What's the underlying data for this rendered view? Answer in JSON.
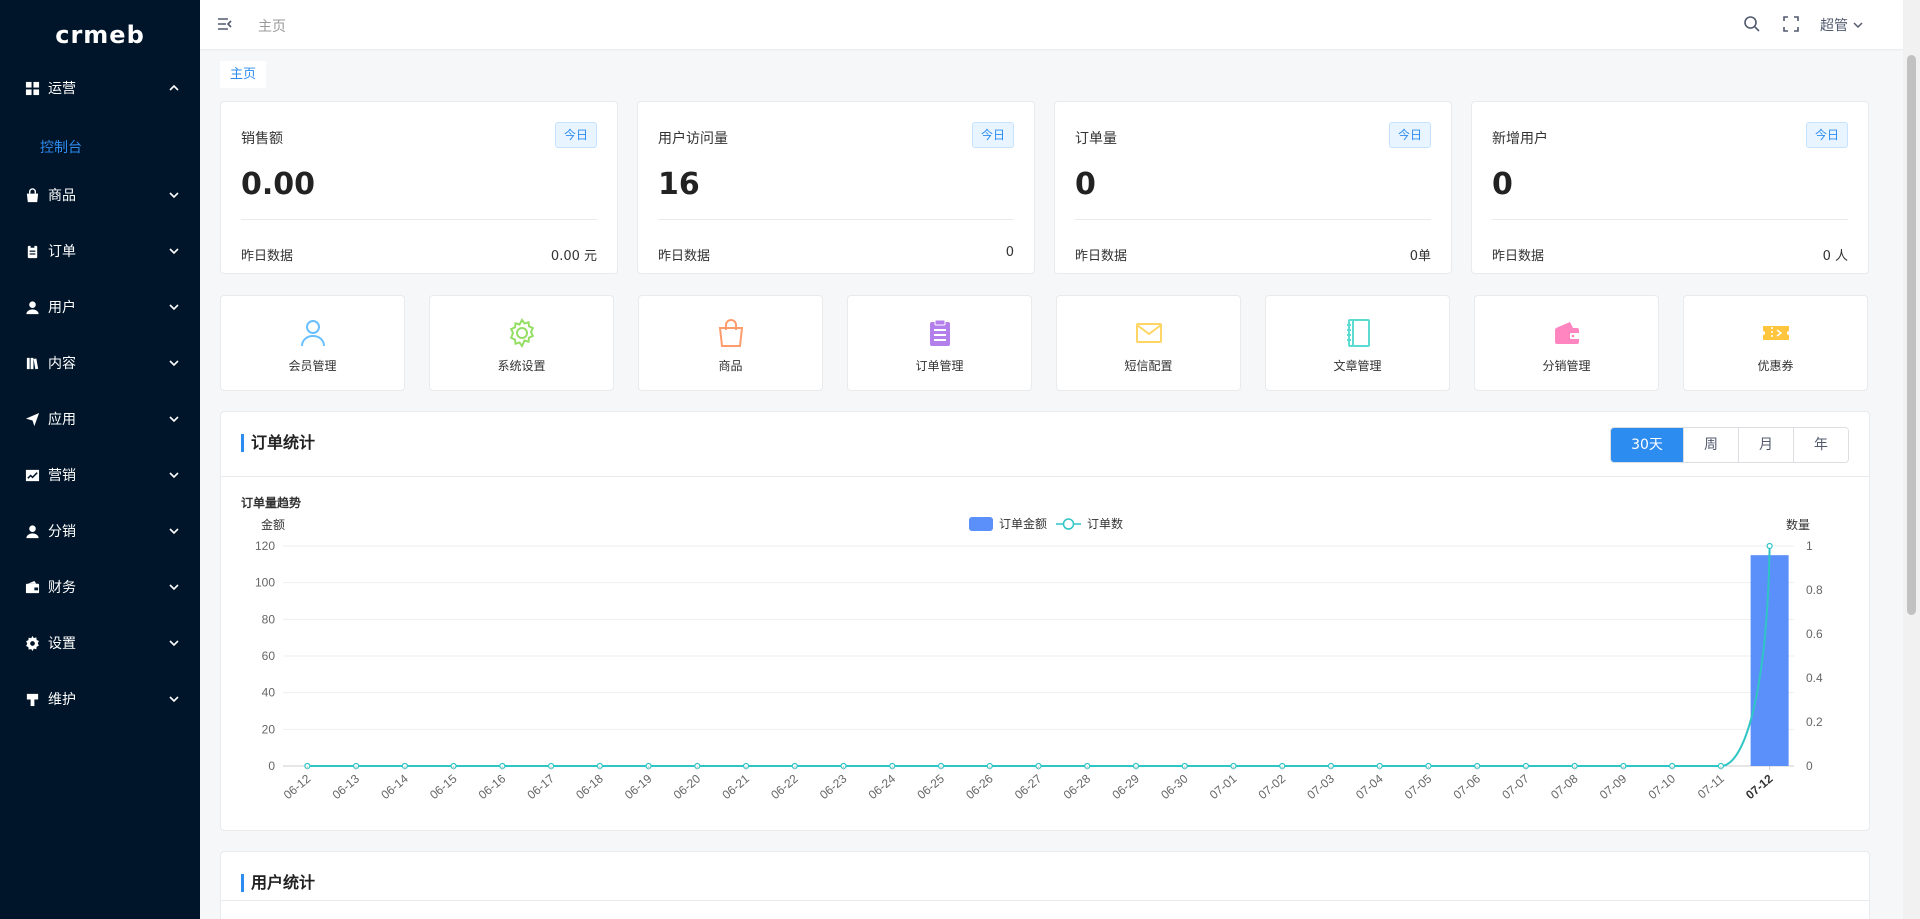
{
  "brand": {
    "logo_text": "crmeb"
  },
  "sidebar": {
    "items": [
      {
        "label": "运营",
        "icon": "grid-icon",
        "expanded": true
      },
      {
        "label": "商品",
        "icon": "bag-icon"
      },
      {
        "label": "订单",
        "icon": "clipboard-icon"
      },
      {
        "label": "用户",
        "icon": "user-icon"
      },
      {
        "label": "内容",
        "icon": "book-icon"
      },
      {
        "label": "应用",
        "icon": "send-icon"
      },
      {
        "label": "营销",
        "icon": "chart-icon"
      },
      {
        "label": "分销",
        "icon": "user-icon"
      },
      {
        "label": "财务",
        "icon": "wallet-icon"
      },
      {
        "label": "设置",
        "icon": "gear-icon"
      },
      {
        "label": "维护",
        "icon": "tool-icon"
      }
    ],
    "sub_active": "控制台"
  },
  "header": {
    "breadcrumb": "主页",
    "user": "超管"
  },
  "tabs": {
    "active": "主页"
  },
  "stats": [
    {
      "title": "销售额",
      "badge": "今日",
      "value": "0.00",
      "foot_label": "昨日数据",
      "foot_value": "0.00 元"
    },
    {
      "title": "用户访问量",
      "badge": "今日",
      "value": "16",
      "foot_label": "昨日数据",
      "foot_value": "0"
    },
    {
      "title": "订单量",
      "badge": "今日",
      "value": "0",
      "foot_label": "昨日数据",
      "foot_value": "0单"
    },
    {
      "title": "新增用户",
      "badge": "今日",
      "value": "0",
      "foot_label": "昨日数据",
      "foot_value": "0 人"
    }
  ],
  "shortcuts": [
    {
      "label": "会员管理",
      "icon": "member-icon",
      "color": "#69c0ff"
    },
    {
      "label": "系统设置",
      "icon": "settings-icon",
      "color": "#95de64"
    },
    {
      "label": "商品",
      "icon": "shopping-bag-icon",
      "color": "#ff9c6e"
    },
    {
      "label": "订单管理",
      "icon": "order-icon",
      "color": "#b37feb"
    },
    {
      "label": "短信配置",
      "icon": "mail-icon",
      "color": "#ffd666"
    },
    {
      "label": "文章管理",
      "icon": "notebook-icon",
      "color": "#5cdbd3"
    },
    {
      "label": "分销管理",
      "icon": "wallet-icon",
      "color": "#ff85c0"
    },
    {
      "label": "优惠券",
      "icon": "coupon-icon",
      "color": "#ffc53d"
    }
  ],
  "order_panel": {
    "title": "订单统计",
    "ranges": [
      "30天",
      "周",
      "月",
      "年"
    ],
    "active_range": "30天",
    "chart_subtitle": "订单量趋势"
  },
  "user_panel": {
    "title": "用户统计"
  },
  "chart_data": {
    "type": "bar",
    "title": "订单量趋势",
    "ylabel_left": "金额",
    "ylabel_right": "数量",
    "ylim_left": [
      0,
      120
    ],
    "ylim_right": [
      0,
      1
    ],
    "yticks_left": [
      0,
      20,
      40,
      60,
      80,
      100,
      120
    ],
    "yticks_right": [
      0,
      0.2,
      0.4,
      0.6,
      0.8,
      1
    ],
    "legend": [
      "订单金额",
      "订单数"
    ],
    "legend_position": "top-center",
    "grid": true,
    "categories": [
      "06-12",
      "06-13",
      "06-14",
      "06-15",
      "06-16",
      "06-17",
      "06-18",
      "06-19",
      "06-20",
      "06-21",
      "06-22",
      "06-23",
      "06-24",
      "06-25",
      "06-26",
      "06-27",
      "06-28",
      "06-29",
      "06-30",
      "07-01",
      "07-02",
      "07-03",
      "07-04",
      "07-05",
      "07-06",
      "07-07",
      "07-08",
      "07-09",
      "07-10",
      "07-11",
      "07-12"
    ],
    "series": [
      {
        "name": "订单金额",
        "type": "bar",
        "axis": "left",
        "color": "#5b8ff9",
        "values": [
          0,
          0,
          0,
          0,
          0,
          0,
          0,
          0,
          0,
          0,
          0,
          0,
          0,
          0,
          0,
          0,
          0,
          0,
          0,
          0,
          0,
          0,
          0,
          0,
          0,
          0,
          0,
          0,
          0,
          0,
          115
        ]
      },
      {
        "name": "订单数",
        "type": "line",
        "axis": "right",
        "color": "#2fc5c5",
        "values": [
          0,
          0,
          0,
          0,
          0,
          0,
          0,
          0,
          0,
          0,
          0,
          0,
          0,
          0,
          0,
          0,
          0,
          0,
          0,
          0,
          0,
          0,
          0,
          0,
          0,
          0,
          0,
          0,
          0,
          0,
          1
        ]
      }
    ]
  }
}
